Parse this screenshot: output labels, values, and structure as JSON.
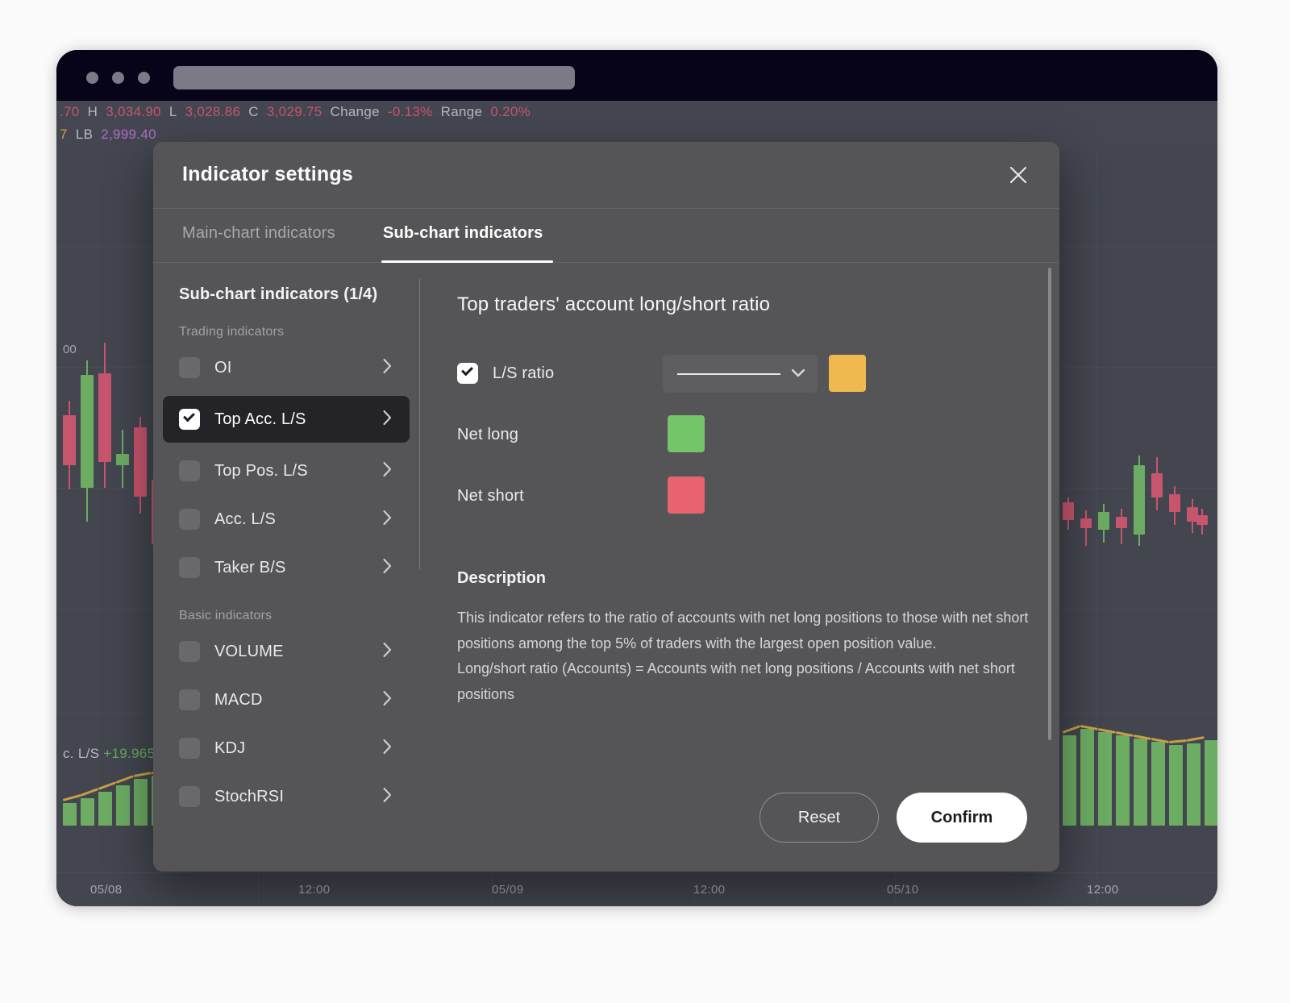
{
  "browser": {
    "address_value": "",
    "address_placeholder": ""
  },
  "ticker": {
    "line1": [
      {
        "text": ".70",
        "kind": "red"
      },
      {
        "text": "H",
        "kind": "label"
      },
      {
        "text": "3,034.90",
        "kind": "red"
      },
      {
        "text": "L",
        "kind": "label"
      },
      {
        "text": "3,028.86",
        "kind": "red"
      },
      {
        "text": "C",
        "kind": "label"
      },
      {
        "text": "3,029.75",
        "kind": "red"
      },
      {
        "text": "Change",
        "kind": "label"
      },
      {
        "text": "-0.13%",
        "kind": "red"
      },
      {
        "text": "Range",
        "kind": "label"
      },
      {
        "text": "0.20%",
        "kind": "red"
      }
    ],
    "line2": [
      {
        "text": "7",
        "kind": "gold"
      },
      {
        "text": "LB",
        "kind": "label"
      },
      {
        "text": "2,999.40",
        "kind": "purple"
      }
    ]
  },
  "chart": {
    "ls_readout_name": "c. L/S",
    "ls_readout_value": "+19.965",
    "time_labels": [
      "05/08",
      "12:00",
      "05/09",
      "12:00",
      "05/10",
      "12:00"
    ],
    "price_tick": "00"
  },
  "chart_data": {
    "type": "line",
    "title": "Top traders' account long/short ratio",
    "xlabel": "",
    "ylabel": "",
    "x": [
      "05/08",
      "12:00",
      "05/09",
      "12:00",
      "05/10",
      "12:00"
    ],
    "series": [
      {
        "name": "L/S ratio",
        "color": "#e3b44d",
        "values": [
          19.9,
          19.95,
          19.96,
          19.94,
          19.97,
          19.965
        ]
      }
    ],
    "legend_position": "top-left",
    "grid": true
  },
  "modal": {
    "title": "Indicator settings",
    "close_icon": "close-icon",
    "tabs": [
      {
        "label": "Main-chart indicators",
        "active": false
      },
      {
        "label": "Sub-chart indicators",
        "active": true
      }
    ],
    "left": {
      "title": "Sub-chart indicators (1/4)",
      "groups": [
        {
          "label": "Trading indicators",
          "items": [
            {
              "label": "OI",
              "checked": false,
              "selected": false
            },
            {
              "label": "Top Acc. L/S",
              "checked": true,
              "selected": true
            },
            {
              "label": "Top Pos. L/S",
              "checked": false,
              "selected": false
            },
            {
              "label": "Acc. L/S",
              "checked": false,
              "selected": false
            },
            {
              "label": "Taker B/S",
              "checked": false,
              "selected": false
            }
          ]
        },
        {
          "label": "Basic indicators",
          "items": [
            {
              "label": "VOLUME",
              "checked": false,
              "selected": false
            },
            {
              "label": "MACD",
              "checked": false,
              "selected": false
            },
            {
              "label": "KDJ",
              "checked": false,
              "selected": false
            },
            {
              "label": "StochRSI",
              "checked": false,
              "selected": false
            }
          ]
        }
      ]
    },
    "right": {
      "title": "Top traders' account long/short ratio",
      "options": [
        {
          "label": "L/S ratio",
          "checked": true,
          "has_line_select": true,
          "color": "#efb950"
        },
        {
          "label": "Net long",
          "checked": null,
          "has_line_select": false,
          "color": "#74c46a"
        },
        {
          "label": "Net short",
          "checked": null,
          "has_line_select": false,
          "color": "#e8626f"
        }
      ],
      "line_style_selected": "solid",
      "description_title": "Description",
      "description_body": "This indicator refers to the ratio of accounts with net long positions to those with net short positions among the top 5% of traders with the largest open position value.\nLong/short ratio (Accounts) = Accounts with net long positions / Accounts with net short positions"
    },
    "footer": {
      "reset_label": "Reset",
      "confirm_label": "Confirm"
    }
  },
  "colors": {
    "up": "#7ac36f",
    "down": "#e2607a",
    "accent_gold": "#e3b44d",
    "modal_bg": "#555558",
    "selected_row": "#242428"
  }
}
